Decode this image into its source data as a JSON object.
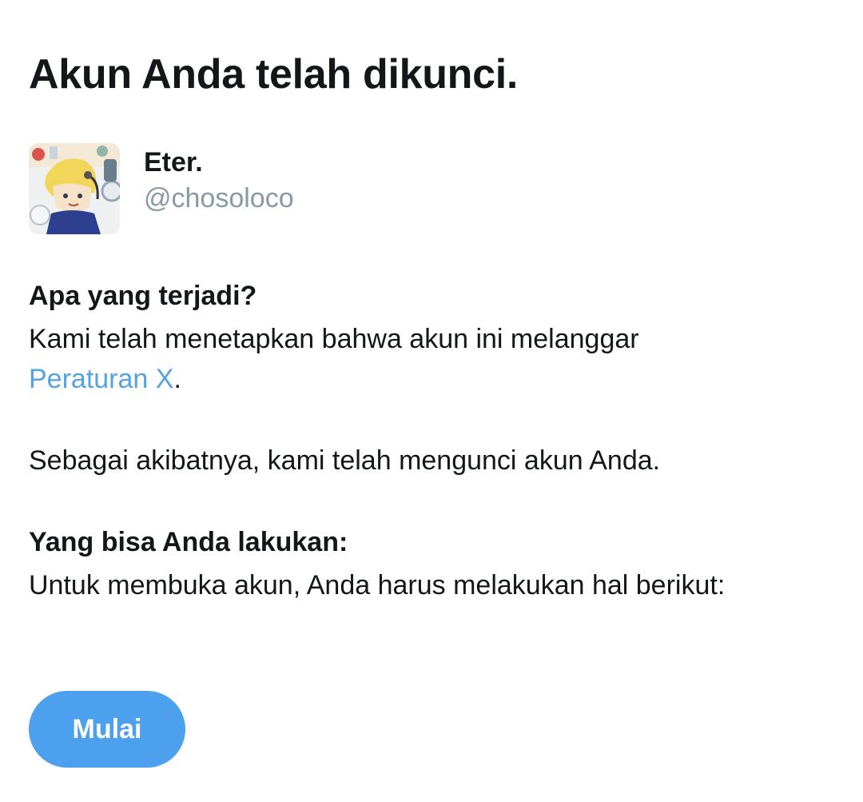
{
  "title": "Akun Anda telah dikunci.",
  "profile": {
    "display_name": "Eter.",
    "handle": "@chosoloco",
    "avatar_icon": "anime-character-avatar"
  },
  "what_happened": {
    "heading": "Apa yang terjadi?",
    "line_before_link": "Kami telah menetapkan bahwa akun ini melanggar",
    "link_text": "Peraturan X",
    "after_link": ".",
    "consequence": "Sebagai akibatnya, kami telah mengunci akun Anda."
  },
  "what_to_do": {
    "heading": "Yang bisa Anda lakukan:",
    "text": "Untuk membuka akun, Anda harus melakukan hal berikut:"
  },
  "start_button_label": "Mulai",
  "colors": {
    "link": "#55a3e3",
    "button": "#4da0ed",
    "handle": "#8899a6",
    "text": "#14171a"
  }
}
